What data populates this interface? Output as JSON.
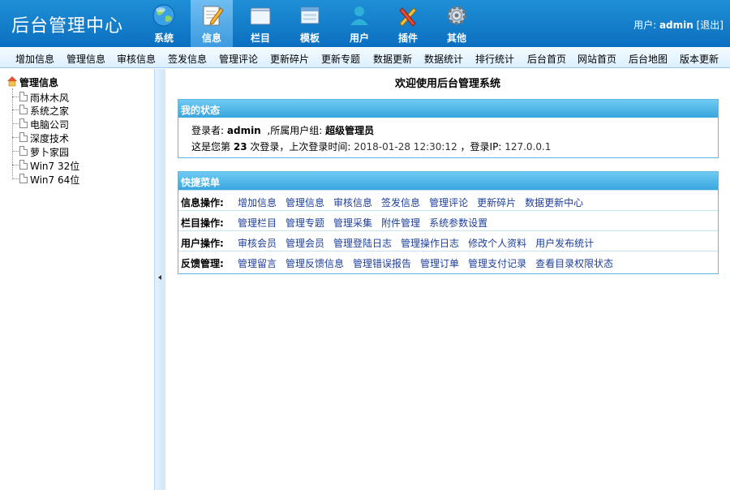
{
  "header": {
    "app_title": "后台管理中心",
    "nav": [
      {
        "label": "系统",
        "icon": "globe-icon"
      },
      {
        "label": "信息",
        "icon": "notepad-pencil-icon",
        "active": true
      },
      {
        "label": "栏目",
        "icon": "folder-icon"
      },
      {
        "label": "模板",
        "icon": "window-icon"
      },
      {
        "label": "用户",
        "icon": "user-icon"
      },
      {
        "label": "插件",
        "icon": "tools-icon"
      },
      {
        "label": "其他",
        "icon": "gear-icon"
      }
    ],
    "user_label": "用户:",
    "username": "admin",
    "logout": "[退出]"
  },
  "submenu": [
    "增加信息",
    "管理信息",
    "审核信息",
    "签发信息",
    "管理评论",
    "更新碎片",
    "更新专题",
    "数据更新",
    "数据统计",
    "排行统计",
    "后台首页",
    "网站首页",
    "后台地图",
    "版本更新"
  ],
  "tree": {
    "root": "管理信息",
    "items": [
      "雨林木风",
      "系统之家",
      "电脑公司",
      "深度技术",
      "萝卜家园",
      "Win7 32位",
      "Win7 64位"
    ]
  },
  "main": {
    "welcome": "欢迎使用后台管理系统",
    "status": {
      "title": "我的状态",
      "login_label": "登录者:",
      "login_user": "admin",
      "group_label": ",所属用户组:",
      "group": "超级管理员",
      "count_prefix": "这是您第",
      "count": "23",
      "count_suffix": "次登录，上次登录时间:",
      "last_time": "2018-01-28 12:30:12",
      "ip_label": "，登录IP:",
      "ip": "127.0.0.1"
    },
    "quick": {
      "title": "快捷菜单",
      "rows": [
        {
          "category": "信息操作:",
          "links": [
            "增加信息",
            "管理信息",
            "审核信息",
            "签发信息",
            "管理评论",
            "更新碎片",
            "数据更新中心"
          ]
        },
        {
          "category": "栏目操作:",
          "links": [
            "管理栏目",
            "管理专题",
            "管理采集",
            "附件管理",
            "系统参数设置"
          ]
        },
        {
          "category": "用户操作:",
          "links": [
            "审核会员",
            "管理会员",
            "管理登陆日志",
            "管理操作日志",
            "修改个人资料",
            "用户发布统计"
          ]
        },
        {
          "category": "反馈管理:",
          "links": [
            "管理留言",
            "管理反馈信息",
            "管理错误报告",
            "管理订单",
            "管理支付记录",
            "查看目录权限状态"
          ]
        }
      ]
    }
  },
  "colors": {
    "header": "#0b6fc0",
    "panel_head": "#39a6de",
    "link": "#1d3f9b"
  }
}
